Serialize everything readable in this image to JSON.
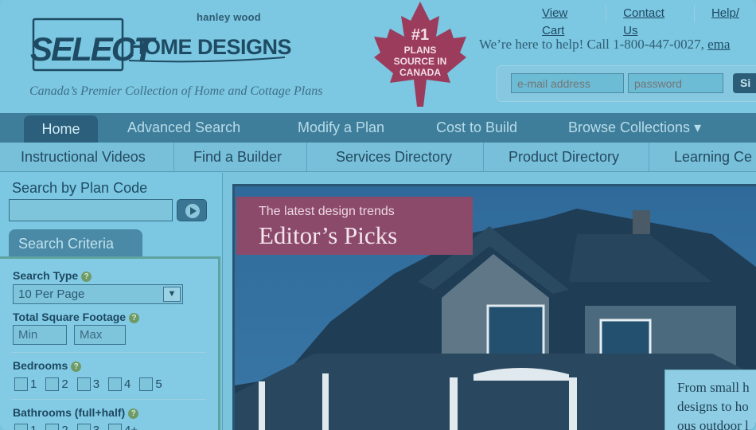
{
  "brand": {
    "publisher": "hanley wood",
    "logo_text": "SELECT HOME DESIGNS",
    "tagline": "Canada’s Premier Collection of Home and Cottage Plans",
    "badge_lines": [
      "#1",
      "PLANS",
      "SOURCE IN",
      "CANADA"
    ]
  },
  "top_links": [
    "View Cart",
    "Contact Us",
    "Help/"
  ],
  "help": {
    "text": "We’re here to help! Call 1-800-447-0027, ",
    "link": "ema"
  },
  "login": {
    "email_placeholder": "e-mail address",
    "password_placeholder": "password",
    "signin_label": "Si"
  },
  "main_nav": [
    "Home",
    "Advanced Search",
    "Modify a Plan",
    "Cost to Build",
    "Browse Collections ▾"
  ],
  "sub_nav": [
    "Instructional Videos",
    "Find a Builder",
    "Services Directory",
    "Product Directory",
    "Learning Ce"
  ],
  "sidebar": {
    "plan_code_title": "Search by Plan Code",
    "criteria_tab": "Search Criteria",
    "search_type_label": "Search Type",
    "search_type_value": "10 Per Page",
    "sqft_label": "Total Square Footage",
    "min_placeholder": "Min",
    "max_placeholder": "Max",
    "bedrooms_label": "Bedrooms",
    "bedroom_options": [
      "1",
      "2",
      "3",
      "4",
      "5"
    ],
    "bathrooms_label": "Bathrooms (full+half)",
    "bathroom_options": [
      "1",
      "2",
      "3",
      "4+"
    ]
  },
  "hero": {
    "kicker": "The latest design trends",
    "title": "Editor’s Picks",
    "promo_text": "From small h\ndesigns to ho\nous outdoor l"
  },
  "colors": {
    "header_bg": "#7cc7e1",
    "nav_bg": "#3f7e9b",
    "badge_bg": "#8c4a6a",
    "leaf": "#9b3c5c"
  }
}
